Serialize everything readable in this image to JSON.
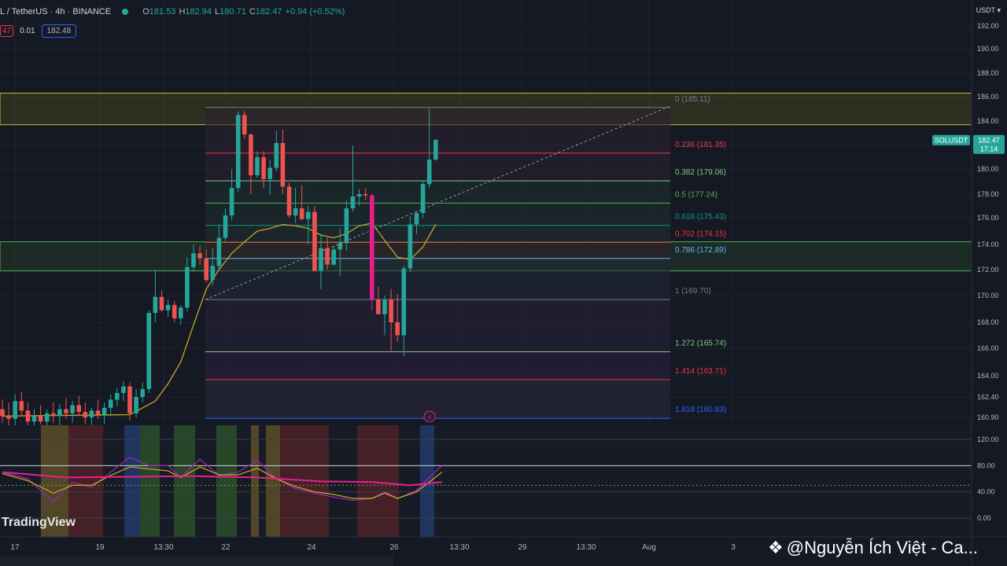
{
  "header": {
    "symbol": "L / TetherUS · 4h · BINANCE",
    "open_label": "O",
    "open": "181.53",
    "high_label": "H",
    "high": "182.94",
    "low_label": "L",
    "low": "180.71",
    "close_label": "C",
    "close": "182.47",
    "change": "+0.94 (+0.52%)"
  },
  "order": {
    "sell": "47",
    "spread": "0.01",
    "buy": "182.48"
  },
  "currency": "USDT",
  "tag_symbol": "SOLUSDT",
  "tag_price": "182.47",
  "tag_timer": "17:14",
  "price_axis": [
    {
      "v": 192,
      "l": "192.00"
    },
    {
      "v": 190,
      "l": "190.00"
    },
    {
      "v": 188,
      "l": "188.00"
    },
    {
      "v": 186,
      "l": "186.00"
    },
    {
      "v": 184,
      "l": "184.00"
    },
    {
      "v": 182,
      "l": "182.00"
    },
    {
      "v": 180,
      "l": "180.00"
    },
    {
      "v": 178,
      "l": "178.00"
    },
    {
      "v": 176,
      "l": "176.00"
    },
    {
      "v": 174,
      "l": "174.00"
    },
    {
      "v": 172,
      "l": "172.00"
    },
    {
      "v": 170,
      "l": "170.00"
    },
    {
      "v": 168,
      "l": "168.00"
    },
    {
      "v": 166,
      "l": "166.00"
    },
    {
      "v": 164,
      "l": "164.00"
    },
    {
      "v": 162.4,
      "l": "162.40"
    },
    {
      "v": 160.9,
      "l": "160.90"
    }
  ],
  "fib_levels": [
    {
      "ratio": "0",
      "price": 185.11,
      "label": "0 (185.11)",
      "color": "#787b86"
    },
    {
      "ratio": "0.236",
      "price": 181.35,
      "label": "0.236 (181.35)",
      "color": "#f23645"
    },
    {
      "ratio": "0.382",
      "price": 179.06,
      "label": "0.382 (179.06)",
      "color": "#81c784"
    },
    {
      "ratio": "0.5",
      "price": 177.24,
      "label": "0.5 (177.24)",
      "color": "#4caf50"
    },
    {
      "ratio": "0.618",
      "price": 175.43,
      "label": "0.618 (175.43)",
      "color": "#089981"
    },
    {
      "ratio": "0.702",
      "price": 174.15,
      "label": "0.702 (174.15)",
      "color": "#f23645"
    },
    {
      "ratio": "0.786",
      "price": 172.89,
      "label": "0.786 (172.89)",
      "color": "#64b5f6"
    },
    {
      "ratio": "1",
      "price": 169.7,
      "label": "1 (169.70)",
      "color": "#787b86"
    },
    {
      "ratio": "1.272",
      "price": 165.74,
      "label": "1.272 (165.74)",
      "color": "#81c784"
    },
    {
      "ratio": "1.414",
      "price": 163.71,
      "label": "1.414 (163.71)",
      "color": "#f23645"
    },
    {
      "ratio": "1.618",
      "price": 160.83,
      "label": "1.618 (160.83)",
      "color": "#2962ff"
    }
  ],
  "supply_zone": [
    183.7,
    186.3
  ],
  "demand_zone": [
    171.9,
    174.2
  ],
  "osc_axis": [
    {
      "v": 120,
      "l": "120.00"
    },
    {
      "v": 80,
      "l": "80.00"
    },
    {
      "v": 40,
      "l": "40.00"
    },
    {
      "v": 0,
      "l": "0.00"
    }
  ],
  "time_axis": [
    "17",
    "19",
    "13:30",
    "22",
    "24",
    "26",
    "13:30",
    "29",
    "13:30",
    "Aug",
    "3"
  ],
  "brand": "TradingView",
  "watermark": "@Nguyễn Ích Việt - Ca...",
  "chart_data": {
    "type": "candlestick",
    "interval": "4h",
    "candles": [
      [
        161.5,
        162.2,
        160.5,
        161.0
      ],
      [
        161.0,
        162.0,
        160.3,
        160.8
      ],
      [
        160.8,
        162.6,
        160.0,
        162.1
      ],
      [
        162.1,
        162.8,
        161.0,
        161.4
      ],
      [
        161.4,
        162.0,
        160.2,
        160.6
      ],
      [
        160.6,
        161.5,
        160.0,
        161.0
      ],
      [
        161.0,
        161.8,
        160.4,
        160.6
      ],
      [
        160.6,
        161.5,
        160.0,
        161.2
      ],
      [
        161.2,
        162.0,
        160.5,
        161.0
      ],
      [
        161.0,
        161.9,
        160.1,
        161.5
      ],
      [
        161.5,
        162.3,
        160.8,
        161.2
      ],
      [
        161.2,
        162.1,
        160.5,
        161.8
      ],
      [
        161.8,
        162.5,
        161.0,
        161.3
      ],
      [
        161.3,
        162.0,
        160.4,
        160.9
      ],
      [
        160.9,
        161.6,
        160.0,
        161.4
      ],
      [
        161.4,
        162.2,
        160.8,
        161.1
      ],
      [
        161.1,
        162.0,
        160.4,
        161.6
      ],
      [
        161.6,
        162.6,
        161.0,
        162.2
      ],
      [
        162.2,
        163.1,
        161.7,
        162.7
      ],
      [
        162.7,
        163.6,
        162.1,
        163.2
      ],
      [
        163.2,
        163.5,
        160.7,
        161.2
      ],
      [
        161.2,
        163.0,
        160.9,
        162.4
      ],
      [
        162.4,
        163.5,
        162.0,
        163.0
      ],
      [
        163.0,
        168.9,
        162.7,
        168.7
      ],
      [
        168.7,
        172.0,
        168.0,
        169.9
      ],
      [
        169.9,
        170.4,
        168.8,
        168.9
      ],
      [
        168.9,
        169.7,
        168.4,
        169.3
      ],
      [
        169.3,
        169.6,
        168.0,
        168.3
      ],
      [
        168.3,
        169.3,
        167.8,
        169.1
      ],
      [
        169.1,
        173.0,
        168.8,
        172.2
      ],
      [
        172.2,
        174.0,
        171.8,
        173.3
      ],
      [
        173.3,
        173.9,
        172.4,
        172.9
      ],
      [
        172.9,
        173.6,
        171.0,
        171.2
      ],
      [
        171.2,
        173.7,
        170.8,
        172.3
      ],
      [
        172.3,
        175.5,
        171.9,
        174.5
      ],
      [
        174.5,
        176.8,
        174.2,
        176.2
      ],
      [
        176.2,
        180.0,
        175.8,
        178.5
      ],
      [
        178.5,
        184.8,
        178.2,
        184.5
      ],
      [
        184.5,
        184.8,
        182.5,
        182.9
      ],
      [
        182.9,
        183.0,
        178.0,
        179.5
      ],
      [
        179.5,
        181.5,
        179.3,
        181.0
      ],
      [
        181.0,
        181.5,
        178.5,
        179.2
      ],
      [
        179.2,
        180.8,
        178.0,
        180.1
      ],
      [
        180.1,
        183.2,
        179.8,
        182.2
      ],
      [
        182.2,
        183.3,
        178.0,
        178.6
      ],
      [
        178.6,
        178.9,
        176.0,
        176.2
      ],
      [
        176.2,
        178.5,
        175.6,
        176.8
      ],
      [
        176.8,
        178.7,
        175.8,
        175.9
      ],
      [
        175.9,
        177.0,
        174.0,
        176.5
      ],
      [
        176.5,
        177.0,
        172.0,
        171.9
      ],
      [
        171.9,
        174.8,
        170.5,
        173.7
      ],
      [
        173.7,
        174.5,
        172.0,
        172.4
      ],
      [
        172.4,
        173.9,
        172.3,
        173.6
      ],
      [
        173.6,
        175.2,
        171.5,
        174.1
      ],
      [
        174.1,
        177.5,
        173.5,
        176.8
      ],
      [
        176.8,
        182.0,
        176.5,
        177.8
      ],
      [
        177.8,
        178.4,
        177.0,
        178.0
      ],
      [
        178.0,
        178.5,
        177.5,
        177.9
      ],
      [
        177.9,
        178.0,
        168.9,
        169.7
      ],
      [
        169.7,
        170.7,
        168.7,
        168.6
      ],
      [
        168.6,
        170.0,
        167.0,
        169.7
      ],
      [
        169.7,
        170.5,
        165.8,
        168.0
      ],
      [
        168.0,
        170.1,
        166.5,
        167.0
      ],
      [
        167.0,
        172.3,
        165.4,
        172.1
      ],
      [
        172.1,
        176.1,
        171.8,
        175.5
      ],
      [
        175.5,
        176.6,
        174.8,
        176.4
      ],
      [
        176.4,
        179.1,
        176.0,
        178.8
      ],
      [
        178.8,
        185.0,
        178.5,
        180.8
      ],
      [
        180.8,
        181.6,
        180.7,
        182.47
      ]
    ],
    "ma": [
      [
        0,
        161.0
      ],
      [
        20,
        161.1
      ],
      [
        24,
        162.1
      ],
      [
        26,
        163.4
      ],
      [
        28,
        165.0
      ],
      [
        30,
        167.8
      ],
      [
        32,
        170.5
      ],
      [
        34,
        172.0
      ],
      [
        36,
        173.3
      ],
      [
        38,
        174.2
      ],
      [
        40,
        175.0
      ],
      [
        42,
        175.2
      ],
      [
        44,
        175.5
      ],
      [
        46,
        175.4
      ],
      [
        48,
        175.2
      ],
      [
        50,
        174.7
      ],
      [
        52,
        174.5
      ],
      [
        54,
        174.8
      ],
      [
        56,
        175.4
      ],
      [
        58,
        175.6
      ],
      [
        60,
        174.3
      ],
      [
        62,
        173.0
      ],
      [
        64,
        172.8
      ],
      [
        66,
        173.8
      ],
      [
        68,
        175.5
      ]
    ],
    "osc_series": {
      "fast": [
        [
          0,
          70
        ],
        [
          4,
          60
        ],
        [
          8,
          25
        ],
        [
          11,
          55
        ],
        [
          14,
          47
        ],
        [
          17,
          70
        ],
        [
          20,
          93
        ],
        [
          23,
          80
        ],
        [
          26,
          80
        ],
        [
          28,
          62
        ],
        [
          31,
          90
        ],
        [
          34,
          65
        ],
        [
          37,
          70
        ],
        [
          40,
          88
        ],
        [
          43,
          60
        ],
        [
          46,
          45
        ],
        [
          49,
          38
        ],
        [
          52,
          32
        ],
        [
          55,
          27
        ],
        [
          58,
          30
        ],
        [
          60,
          40
        ],
        [
          62,
          30
        ],
        [
          65,
          42
        ],
        [
          67,
          62
        ],
        [
          69,
          80
        ]
      ],
      "signal": [
        [
          0,
          68
        ],
        [
          4,
          57
        ],
        [
          8,
          38
        ],
        [
          11,
          50
        ],
        [
          14,
          50
        ],
        [
          17,
          65
        ],
        [
          20,
          78
        ],
        [
          23,
          75
        ],
        [
          26,
          72
        ],
        [
          28,
          62
        ],
        [
          31,
          78
        ],
        [
          34,
          66
        ],
        [
          37,
          66
        ],
        [
          40,
          76
        ],
        [
          43,
          60
        ],
        [
          46,
          48
        ],
        [
          49,
          40
        ],
        [
          52,
          36
        ],
        [
          55,
          30
        ],
        [
          58,
          30
        ],
        [
          60,
          38
        ],
        [
          62,
          30
        ],
        [
          65,
          40
        ],
        [
          67,
          55
        ],
        [
          69,
          70
        ]
      ],
      "slow": [
        [
          0,
          70
        ],
        [
          10,
          62
        ],
        [
          20,
          63
        ],
        [
          30,
          64
        ],
        [
          40,
          62
        ],
        [
          50,
          56
        ],
        [
          58,
          55
        ],
        [
          64,
          50
        ],
        [
          69,
          55
        ]
      ]
    }
  }
}
